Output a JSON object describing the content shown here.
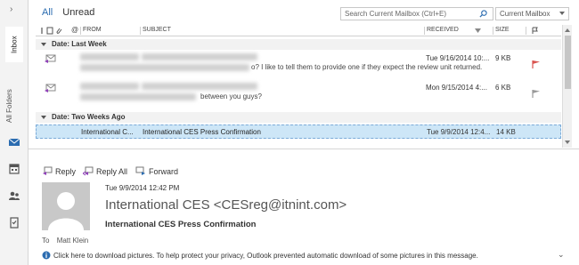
{
  "nav": {
    "collapse_glyph": "›",
    "inbox_label": "Inbox",
    "all_folders_label": "All Folders",
    "icons": [
      "mail-icon",
      "calendar-icon",
      "people-icon",
      "tasks-icon"
    ]
  },
  "header": {
    "tab_all": "All",
    "tab_unread": "Unread",
    "search_placeholder": "Search Current Mailbox (Ctrl+E)",
    "scope": "Current Mailbox"
  },
  "columns": {
    "from": "FROM",
    "subject": "SUBJECT",
    "received": "RECEIVED",
    "size": "SIZE"
  },
  "groups": [
    {
      "label": "Date: Last Week"
    },
    {
      "label": "Date: Two Weeks Ago"
    }
  ],
  "messages": [
    {
      "preview": "o? I like to tell them to provide one if they expect the review unit returned.",
      "received": "Tue 9/16/2014 10:...",
      "size": "9 KB",
      "flag": "red"
    },
    {
      "preview": "between you guys?",
      "received": "Mon 9/15/2014 4:...",
      "size": "6 KB",
      "flag": "gray"
    },
    {
      "from": "International C...",
      "subject": "International CES Press Confirmation",
      "received": "Tue 9/9/2014 12:4...",
      "size": "14 KB",
      "selected": true
    }
  ],
  "reading": {
    "reply": "Reply",
    "reply_all": "Reply All",
    "forward": "Forward",
    "date": "Tue 9/9/2014 12:42 PM",
    "sender": "International CES <CESreg@itnint.com>",
    "subject": "International CES Press Confirmation",
    "to_label": "To",
    "to_name": "Matt Klein",
    "info": "Click here to download pictures. To help protect your privacy, Outlook prevented automatic download of some pictures in this message."
  },
  "colors": {
    "accent": "#2b6cb0",
    "selected_row": "#cde6f7",
    "flag_red": "#d9534f",
    "flag_gray": "#9a9a9a"
  }
}
